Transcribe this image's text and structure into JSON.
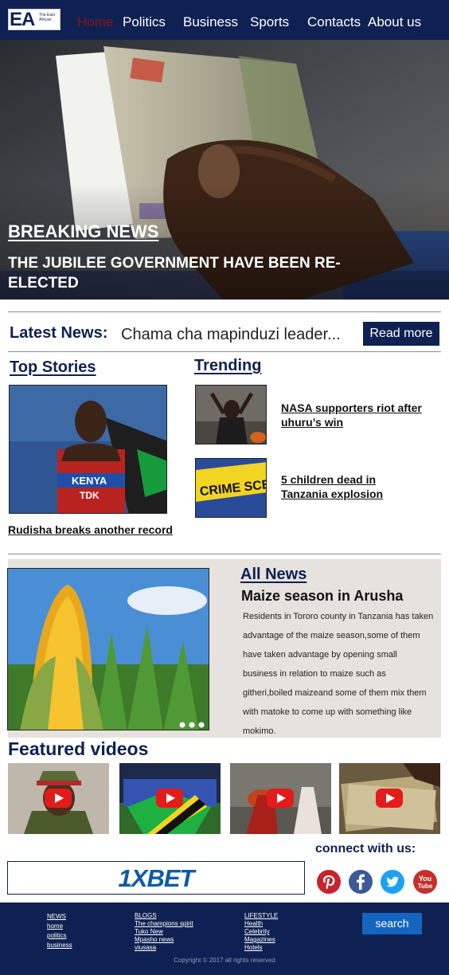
{
  "nav": {
    "logo": {
      "letters": "EA",
      "tagline": "The East African"
    },
    "links": [
      "Home",
      "Politics",
      "Business",
      "Sports",
      "Contacts",
      "About us"
    ],
    "active_color": "#8a1515",
    "background": "#0e2152"
  },
  "hero": {
    "kicker": "BREAKING NEWS",
    "headline": "THE JUBILEE GOVERNMENT HAVE BEEN RE-ELECTED"
  },
  "latest": {
    "label": "Latest News:",
    "text": "Chama cha mapinduzi leader...",
    "button": "Read more"
  },
  "top_stories": {
    "heading": "Top Stories",
    "title": "Rudisha breaks another record"
  },
  "trending": {
    "heading": "Trending",
    "items": [
      {
        "title": "NASA supporters riot after uhuru’s win"
      },
      {
        "title": "5 children dead in Tanzania explosion"
      }
    ]
  },
  "all_news": {
    "heading": "All News",
    "title": "Maize season in Arusha",
    "body": "Residents in Tororo county in Tanzania has taken advantage of the maize season,some of them have taken advantage by opening small business in relation to maize such as githeri,boiled maizeand some of them mix them with matoke to come  up with something like mokimo."
  },
  "featured": {
    "heading": "Featured videos"
  },
  "ad": {
    "text": "1XBET"
  },
  "connect": {
    "label": "connect with us:",
    "icons": [
      "pinterest-icon",
      "facebook-icon",
      "twitter-icon",
      "youtube-icon"
    ],
    "youtube_lines": [
      "You",
      "Tube"
    ]
  },
  "footer": {
    "col1": {
      "heading": "NEWS",
      "links": [
        "home",
        "politics",
        "business"
      ]
    },
    "col2": {
      "heading": "BLOGS",
      "links": [
        "The champions spirit",
        "Tuko New",
        "Mpasho news",
        "viusasa"
      ]
    },
    "col3": {
      "heading": "LIFESTYLE",
      "links": [
        "Health",
        "Celebrity",
        "Magazines",
        "Hotels"
      ]
    },
    "search": "search",
    "copyright": "Copyright © 2017 all rights reserved"
  }
}
